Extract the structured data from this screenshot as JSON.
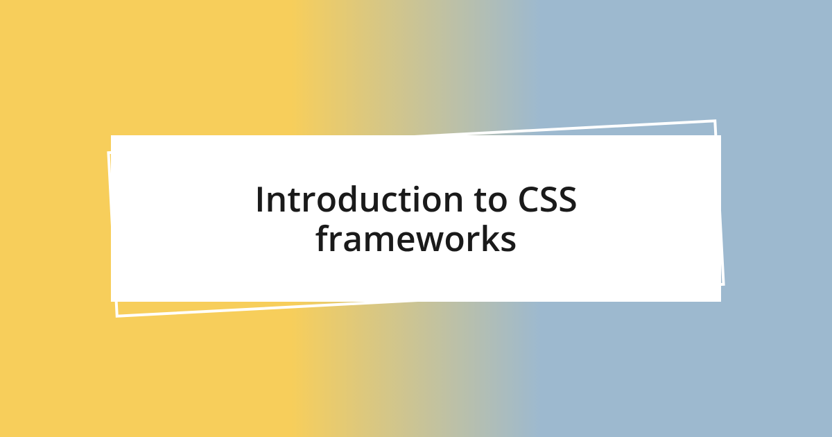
{
  "title": "Introduction to CSS frameworks"
}
